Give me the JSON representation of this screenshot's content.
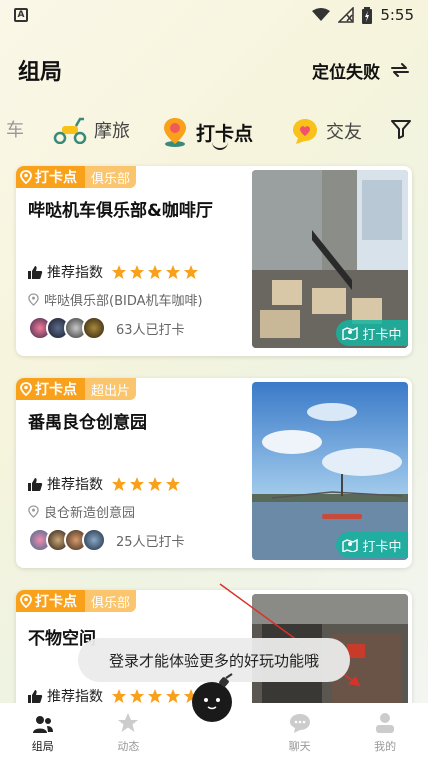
{
  "status_bar": {
    "time": "5:55"
  },
  "header": {
    "title": "组局",
    "location_label": "定位失败"
  },
  "tabs": [
    {
      "label": "车"
    },
    {
      "label": "摩旅"
    },
    {
      "label": "打卡点"
    },
    {
      "label": "交友"
    }
  ],
  "cards": [
    {
      "badge": "打卡点",
      "tag": "俱乐部",
      "title": "哔哒机车俱乐部&咖啡厅",
      "rating_label": "推荐指数",
      "stars": 5,
      "address": "哔哒俱乐部(BIDA机车咖啡)",
      "checkin_count": "63人已打卡",
      "checkin_button": "打卡中"
    },
    {
      "badge": "打卡点",
      "tag": "超出片",
      "title": "番禺良仓创意园",
      "rating_label": "推荐指数",
      "stars": 4,
      "address": "良仓新造创意园",
      "checkin_count": "25人已打卡",
      "checkin_button": "打卡中"
    },
    {
      "badge": "打卡点",
      "tag": "俱乐部",
      "title": "不物空间",
      "rating_label": "推荐指数",
      "stars": 5
    }
  ],
  "toast": "登录才能体验更多的好玩功能哦",
  "bottom_nav": [
    {
      "label": "组局"
    },
    {
      "label": "动态"
    },
    {
      "label": "聊天"
    },
    {
      "label": "我的"
    }
  ],
  "colors": {
    "badge": "#f9a11b",
    "badge_sub": "#fbc56d",
    "checkin": "#14b4a0",
    "star": "#f9a11b"
  }
}
